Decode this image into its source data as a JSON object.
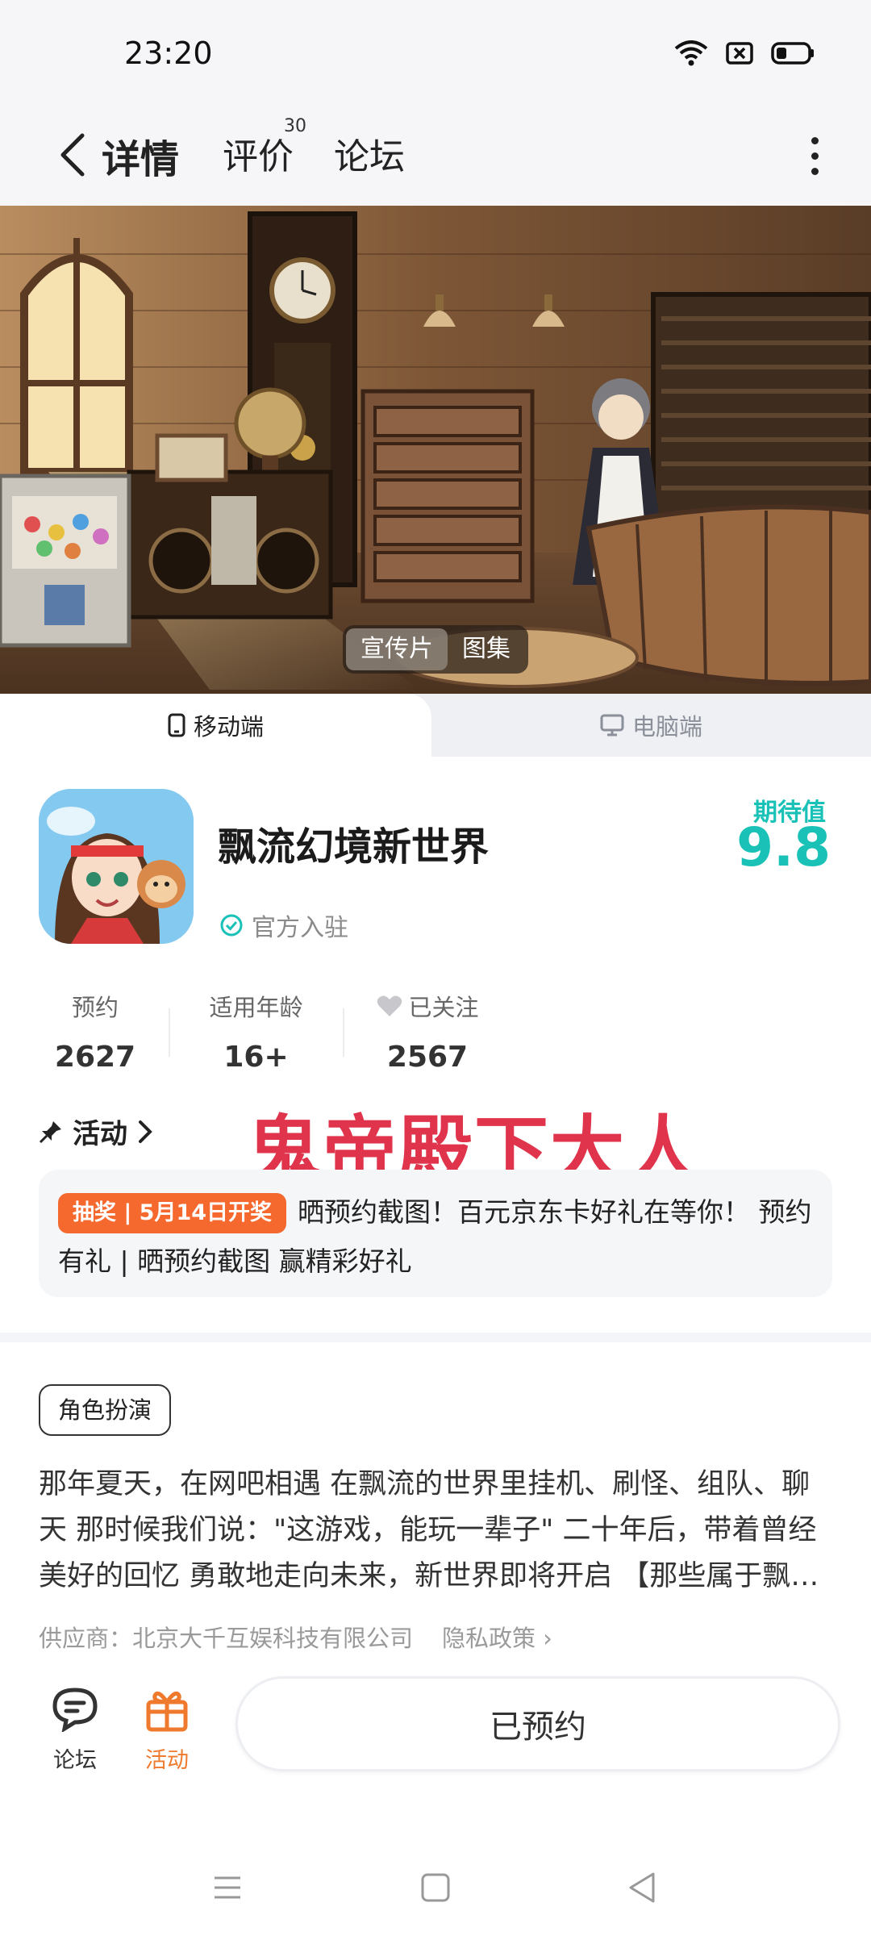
{
  "status_bar": {
    "time": "23:20"
  },
  "nav": {
    "tabs": [
      {
        "label": "详情"
      },
      {
        "label": "评价",
        "badge": "30"
      },
      {
        "label": "论坛"
      }
    ]
  },
  "banner": {
    "toggle": [
      "宣传片",
      "图集"
    ]
  },
  "platform_tabs": [
    "移动端",
    "电脑端"
  ],
  "app": {
    "title": "飘流幻境新世界",
    "official": "官方入驻",
    "expect_label": "期待值",
    "expect_score": "9.8"
  },
  "stats": [
    {
      "label": "预约",
      "value": "2627"
    },
    {
      "label": "适用年龄",
      "value": "16+"
    },
    {
      "label": "已关注",
      "value": "2567"
    }
  ],
  "activity": {
    "header": "活动",
    "tag": "抽奖 | 5月14日开奖",
    "text": "晒预约截图！百元京东卡好礼在等你！ 预约有礼 | 晒预约截图 赢精彩好礼"
  },
  "watermark": "鬼帝殿下大人",
  "genre": "角色扮演",
  "description": "那年夏天，在网吧相遇 在飘流的世界里挂机、刷怪、组队、聊天 那时候我们说：\"这游戏，能玩一辈子\" 二十年后，带着曾经美好的回忆 勇敢地走向未来，新世界即将开启 【那些属于飘…",
  "supplier": {
    "text": "供应商：北京大千互娱科技有限公司",
    "privacy": "隐私政策"
  },
  "bottom_bar": {
    "forum": "论坛",
    "activity": "活动",
    "reserve_button": "已预约"
  },
  "colors": {
    "accent": "#17d1c5",
    "score": "#19c1b6",
    "activity_tag": "#f5692f",
    "watermark": "#e0344c"
  }
}
